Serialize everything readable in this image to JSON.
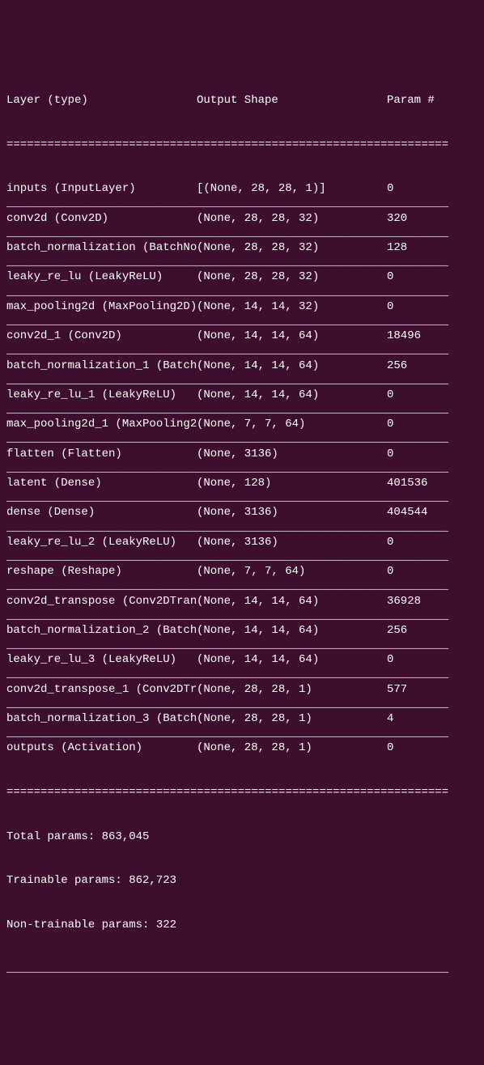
{
  "headers": {
    "layer": "Layer (type)",
    "shape": "Output Shape",
    "param": "Param #"
  },
  "dividers": {
    "equals": "=================================================================",
    "underscore": "_________________________________________________________________"
  },
  "rows": [
    {
      "layer": "inputs (InputLayer)",
      "shape": "[(None, 28, 28, 1)]",
      "param": "0"
    },
    {
      "layer": "conv2d (Conv2D)",
      "shape": "(None, 28, 28, 32)",
      "param": "320"
    },
    {
      "layer": "batch_normalization (BatchNo",
      "shape": "(None, 28, 28, 32)",
      "param": "128"
    },
    {
      "layer": "leaky_re_lu (LeakyReLU)",
      "shape": "(None, 28, 28, 32)",
      "param": "0"
    },
    {
      "layer": "max_pooling2d (MaxPooling2D)",
      "shape": "(None, 14, 14, 32)",
      "param": "0"
    },
    {
      "layer": "conv2d_1 (Conv2D)",
      "shape": "(None, 14, 14, 64)",
      "param": "18496"
    },
    {
      "layer": "batch_normalization_1 (Batch",
      "shape": "(None, 14, 14, 64)",
      "param": "256"
    },
    {
      "layer": "leaky_re_lu_1 (LeakyReLU)",
      "shape": "(None, 14, 14, 64)",
      "param": "0"
    },
    {
      "layer": "max_pooling2d_1 (MaxPooling2",
      "shape": "(None, 7, 7, 64)",
      "param": "0"
    },
    {
      "layer": "flatten (Flatten)",
      "shape": "(None, 3136)",
      "param": "0"
    },
    {
      "layer": "latent (Dense)",
      "shape": "(None, 128)",
      "param": "401536"
    },
    {
      "layer": "dense (Dense)",
      "shape": "(None, 3136)",
      "param": "404544"
    },
    {
      "layer": "leaky_re_lu_2 (LeakyReLU)",
      "shape": "(None, 3136)",
      "param": "0"
    },
    {
      "layer": "reshape (Reshape)",
      "shape": "(None, 7, 7, 64)",
      "param": "0"
    },
    {
      "layer": "conv2d_transpose (Conv2DTran",
      "shape": "(None, 14, 14, 64)",
      "param": "36928"
    },
    {
      "layer": "batch_normalization_2 (Batch",
      "shape": "(None, 14, 14, 64)",
      "param": "256"
    },
    {
      "layer": "leaky_re_lu_3 (LeakyReLU)",
      "shape": "(None, 14, 14, 64)",
      "param": "0"
    },
    {
      "layer": "conv2d_transpose_1 (Conv2DTr",
      "shape": "(None, 28, 28, 1)",
      "param": "577"
    },
    {
      "layer": "batch_normalization_3 (Batch",
      "shape": "(None, 28, 28, 1)",
      "param": "4"
    },
    {
      "layer": "outputs (Activation)",
      "shape": "(None, 28, 28, 1)",
      "param": "0"
    }
  ],
  "summary": {
    "total": "Total params: 863,045",
    "trainable": "Trainable params: 862,723",
    "nontrainable": "Non-trainable params: 322"
  }
}
